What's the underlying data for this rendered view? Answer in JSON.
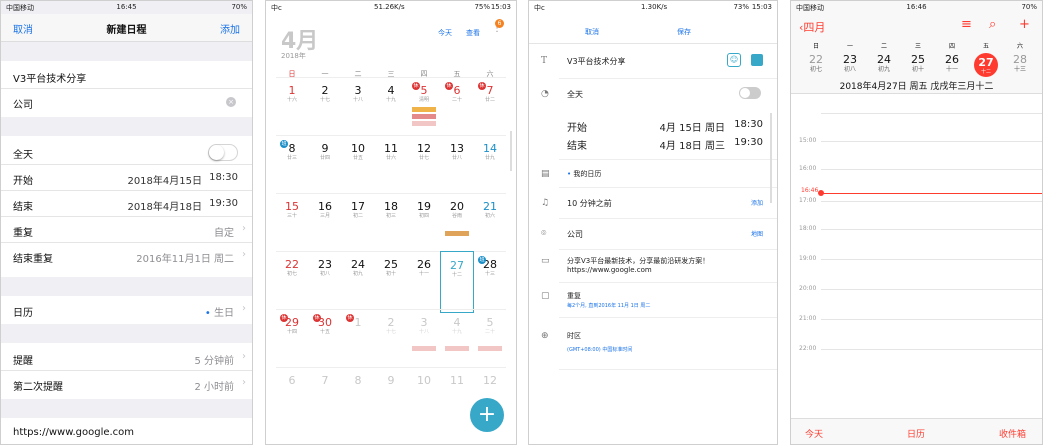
{
  "s1": {
    "status": {
      "carrier": "中国移动",
      "time": "16:45",
      "battery": "70%"
    },
    "nav": {
      "cancel": "取消",
      "title": "新建日程",
      "add": "添加"
    },
    "title_field": "V3平台技术分享",
    "location_field": "公司",
    "rows": {
      "allday": "全天",
      "start_label": "开始",
      "start_date": "2018年4月15日",
      "start_time": "18:30",
      "end_label": "结束",
      "end_date": "2018年4月18日",
      "end_time": "19:30",
      "repeat_label": "重复",
      "repeat_value": "自定",
      "end_repeat_label": "结束重复",
      "end_repeat_value": "2016年11月1日 周二",
      "calendar_label": "日历",
      "calendar_value": "生日",
      "alert_label": "提醒",
      "alert_value": "5 分钟前",
      "second_alert_label": "第二次提醒",
      "second_alert_value": "2 小时前",
      "url": "https://www.google.com"
    }
  },
  "s2": {
    "status": {
      "left": "中c",
      "center": "51.26K/s",
      "battery": "75%",
      "time": "15:03"
    },
    "month": "4月",
    "year": "2018年",
    "today": "今天",
    "view": "查看",
    "badge": "6",
    "weekdays": [
      "日",
      "一",
      "二",
      "三",
      "四",
      "五",
      "六"
    ],
    "weeks": [
      [
        {
          "n": "1",
          "l": "十六",
          "c": "red"
        },
        {
          "n": "2",
          "l": "十七"
        },
        {
          "n": "3",
          "l": "十八"
        },
        {
          "n": "4",
          "l": "十九"
        },
        {
          "n": "5",
          "l": "清明",
          "c": "red",
          "b": "休"
        },
        {
          "n": "6",
          "l": "二十",
          "c": "red",
          "b": "休"
        },
        {
          "n": "7",
          "l": "廿二",
          "c": "red",
          "b": "休"
        }
      ],
      [
        {
          "n": "8",
          "l": "廿三",
          "b": "班"
        },
        {
          "n": "9",
          "l": "廿四"
        },
        {
          "n": "10",
          "l": "廿五"
        },
        {
          "n": "11",
          "l": "廿六"
        },
        {
          "n": "12",
          "l": "廿七"
        },
        {
          "n": "13",
          "l": "廿八"
        },
        {
          "n": "14",
          "l": "廿九",
          "c": "blue"
        }
      ],
      [
        {
          "n": "15",
          "l": "三十",
          "c": "red"
        },
        {
          "n": "16",
          "l": "三月"
        },
        {
          "n": "17",
          "l": "初二"
        },
        {
          "n": "18",
          "l": "初三"
        },
        {
          "n": "19",
          "l": "初四"
        },
        {
          "n": "20",
          "l": "谷雨"
        },
        {
          "n": "21",
          "l": "初六",
          "c": "blue"
        }
      ],
      [
        {
          "n": "22",
          "l": "初七",
          "c": "red"
        },
        {
          "n": "23",
          "l": "初八"
        },
        {
          "n": "24",
          "l": "初九"
        },
        {
          "n": "25",
          "l": "初十"
        },
        {
          "n": "26",
          "l": "十一"
        },
        {
          "n": "27",
          "l": "十二",
          "sel": true
        },
        {
          "n": "28",
          "l": "十三",
          "b": "班"
        }
      ],
      [
        {
          "n": "29",
          "l": "十四",
          "c": "red",
          "b": "休"
        },
        {
          "n": "30",
          "l": "十五",
          "c": "red",
          "b": "休"
        },
        {
          "n": "1",
          "l": "",
          "g": true,
          "b": "休"
        },
        {
          "n": "2",
          "l": "十七",
          "g": true
        },
        {
          "n": "3",
          "l": "十八",
          "g": true
        },
        {
          "n": "4",
          "l": "十九",
          "g": true
        },
        {
          "n": "5",
          "l": "二十",
          "g": true
        }
      ],
      [
        {
          "n": "6",
          "l": "",
          "g": true
        },
        {
          "n": "7",
          "l": "",
          "g": true
        },
        {
          "n": "8",
          "l": "",
          "g": true
        },
        {
          "n": "9",
          "l": "",
          "g": true
        },
        {
          "n": "10",
          "l": "",
          "g": true
        },
        {
          "n": "11",
          "l": "",
          "g": true
        },
        {
          "n": "12",
          "l": "",
          "g": true
        }
      ]
    ],
    "fab": "+"
  },
  "s3": {
    "status": {
      "left": "中c",
      "center": "1.30K/s",
      "battery": "73%",
      "time": "15:03"
    },
    "cancel": "取消",
    "save": "保存",
    "title": "V3平台技术分享",
    "allday": "全天",
    "start_label": "开始",
    "start_value": "4月 15日 周日",
    "start_time": "18:30",
    "end_label": "结束",
    "end_value": "4月 18日 周三",
    "end_time": "19:30",
    "calendar": "我的日历",
    "reminder": "10 分钟之前",
    "reminder_add": "添加",
    "location": "公司",
    "location_action": "地图",
    "note": "分享V3平台最新技术，分享最前沿研发方案！",
    "note_url": "https://www.google.com",
    "repeat_label": "重复",
    "repeat_value": "每2个月, 直到2016年 11月 1日 周二",
    "timezone_label": "时区",
    "timezone_value": "(GMT+08:00) 中国标准时间"
  },
  "s4": {
    "status": {
      "carrier": "中国移动",
      "time": "16:46",
      "battery": "70%"
    },
    "back": "四月",
    "weekdays": [
      "日",
      "一",
      "二",
      "三",
      "四",
      "五",
      "六"
    ],
    "days": [
      {
        "n": "22",
        "l": "初七"
      },
      {
        "n": "23",
        "l": "初八"
      },
      {
        "n": "24",
        "l": "初九"
      },
      {
        "n": "25",
        "l": "初十"
      },
      {
        "n": "26",
        "l": "十一"
      },
      {
        "n": "27",
        "l": "十二",
        "sel": true
      },
      {
        "n": "28",
        "l": "十三"
      }
    ],
    "date_line": "2018年4月27日 周五  戊戌年三月十二",
    "times": [
      "",
      "15:00",
      "16:00",
      "16:46",
      "17:00",
      "18:00",
      "19:00",
      "20:00",
      "21:00",
      "22:00"
    ],
    "tabs": {
      "today": "今天",
      "calendar": "日历",
      "inbox": "收件箱"
    }
  }
}
